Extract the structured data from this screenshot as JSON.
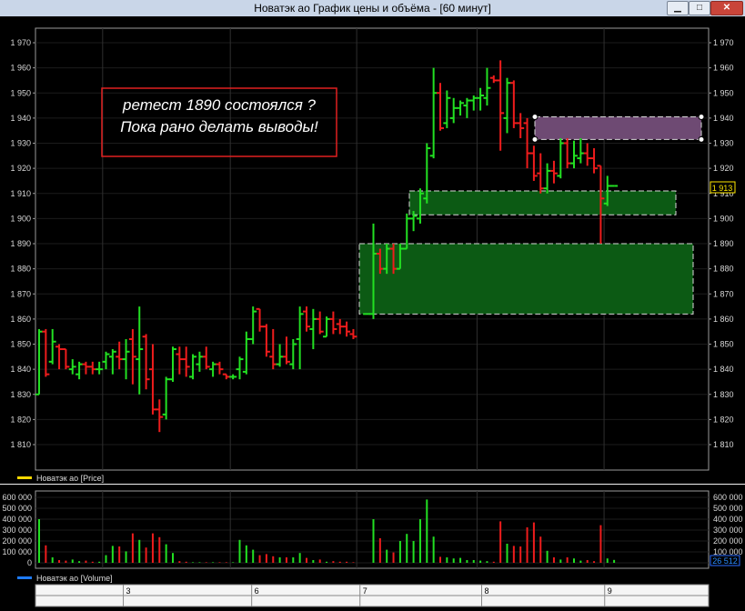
{
  "window": {
    "title": "Новатэк ао График цены и объёма - [60 минут]",
    "buttons": {
      "minimize": "▁",
      "maximize": "□",
      "close": "✕"
    }
  },
  "price_panel": {
    "legend": "Новатэк ао [Price]",
    "legend_color": "#ffd800",
    "current_price_label": "1 913",
    "y_ticks": [
      "1 970",
      "1 960",
      "1 950",
      "1 940",
      "1 930",
      "1 920",
      "1 910",
      "1 900",
      "1 890",
      "1 880",
      "1 870",
      "1 860",
      "1 850",
      "1 840",
      "1 830",
      "1 820",
      "1 810"
    ]
  },
  "volume_panel": {
    "legend": "Новатэк ао [Volume]",
    "legend_color": "#1e7bff",
    "current_volume_label": "26 512",
    "y_ticks": [
      "600 000",
      "500 000",
      "400 000",
      "300 000",
      "200 000",
      "100 000",
      "0"
    ]
  },
  "annotation": {
    "line1": "ретест 1890  состоялся ?",
    "line2": "Пока рано делать выводы!"
  },
  "x_axis": {
    "day_labels": [
      "3",
      "6",
      "7",
      "8",
      "9"
    ]
  },
  "colors": {
    "up": "#22e022",
    "down": "#ee1c1c",
    "background": "#000000",
    "grid": "#3a3a3a",
    "zone_green": "#0c5a14",
    "zone_purple": "#6e4a73"
  },
  "zones": [
    {
      "name": "zone-resistance-1930-1940",
      "from": 1931.5,
      "to": 1940.5,
      "kind": "purple"
    },
    {
      "name": "zone-support-1901-1911",
      "from": 1901.5,
      "to": 1911,
      "kind": "green"
    },
    {
      "name": "zone-support-1862-1890",
      "from": 1862,
      "to": 1890,
      "kind": "green"
    }
  ],
  "chart_data": {
    "type": "ohlc",
    "period": "60 минут",
    "ylim": [
      1802,
      1974
    ],
    "candles": [
      {
        "o": 1830,
        "h": 1856,
        "l": 1830,
        "c": 1855
      },
      {
        "o": 1855,
        "h": 1856,
        "l": 1837,
        "c": 1838
      },
      {
        "o": 1843,
        "h": 1856,
        "l": 1842,
        "c": 1851
      },
      {
        "o": 1849,
        "h": 1850,
        "l": 1840,
        "c": 1848
      },
      {
        "o": 1848,
        "h": 1848,
        "l": 1840,
        "c": 1841
      },
      {
        "o": 1840,
        "h": 1844,
        "l": 1838,
        "c": 1841
      },
      {
        "o": 1838,
        "h": 1843,
        "l": 1836,
        "c": 1842
      },
      {
        "o": 1842,
        "h": 1843,
        "l": 1838,
        "c": 1841
      },
      {
        "o": 1841,
        "h": 1843,
        "l": 1838,
        "c": 1840
      },
      {
        "o": 1840,
        "h": 1843,
        "l": 1838,
        "c": 1840
      },
      {
        "o": 1843,
        "h": 1847,
        "l": 1840,
        "c": 1846
      },
      {
        "o": 1845,
        "h": 1848,
        "l": 1838,
        "c": 1847
      },
      {
        "o": 1845,
        "h": 1851,
        "l": 1840,
        "c": 1844
      },
      {
        "o": 1844,
        "h": 1852,
        "l": 1836,
        "c": 1847
      },
      {
        "o": 1852,
        "h": 1856,
        "l": 1834,
        "c": 1845
      },
      {
        "o": 1844,
        "h": 1865,
        "l": 1830,
        "c": 1848
      },
      {
        "o": 1853,
        "h": 1854,
        "l": 1832,
        "c": 1836
      },
      {
        "o": 1840,
        "h": 1850,
        "l": 1822,
        "c": 1824
      },
      {
        "o": 1824,
        "h": 1828,
        "l": 1815,
        "c": 1821
      },
      {
        "o": 1822,
        "h": 1837,
        "l": 1820,
        "c": 1836
      },
      {
        "o": 1836,
        "h": 1849,
        "l": 1835,
        "c": 1848
      },
      {
        "o": 1846,
        "h": 1849,
        "l": 1838,
        "c": 1844
      },
      {
        "o": 1844,
        "h": 1849,
        "l": 1837,
        "c": 1841
      },
      {
        "o": 1837,
        "h": 1846,
        "l": 1836,
        "c": 1845
      },
      {
        "o": 1842,
        "h": 1847,
        "l": 1839,
        "c": 1845
      },
      {
        "o": 1845,
        "h": 1849,
        "l": 1840,
        "c": 1841
      },
      {
        "o": 1840,
        "h": 1843,
        "l": 1837,
        "c": 1842
      },
      {
        "o": 1842,
        "h": 1843,
        "l": 1838,
        "c": 1840
      },
      {
        "o": 1838,
        "h": 1838,
        "l": 1836,
        "c": 1837
      },
      {
        "o": 1837,
        "h": 1838,
        "l": 1836,
        "c": 1837
      },
      {
        "o": 1840,
        "h": 1845,
        "l": 1836,
        "c": 1844
      },
      {
        "o": 1839,
        "h": 1855,
        "l": 1838,
        "c": 1852
      },
      {
        "o": 1852,
        "h": 1865,
        "l": 1850,
        "c": 1863
      },
      {
        "o": 1864,
        "h": 1864,
        "l": 1855,
        "c": 1857
      },
      {
        "o": 1857,
        "h": 1858,
        "l": 1845,
        "c": 1847
      },
      {
        "o": 1845,
        "h": 1856,
        "l": 1840,
        "c": 1842
      },
      {
        "o": 1842,
        "h": 1850,
        "l": 1841,
        "c": 1845
      },
      {
        "o": 1845,
        "h": 1853,
        "l": 1842,
        "c": 1843
      },
      {
        "o": 1842,
        "h": 1852,
        "l": 1840,
        "c": 1850
      },
      {
        "o": 1852,
        "h": 1865,
        "l": 1840,
        "c": 1862
      },
      {
        "o": 1863,
        "h": 1865,
        "l": 1855,
        "c": 1857
      },
      {
        "o": 1856,
        "h": 1864,
        "l": 1848,
        "c": 1860
      },
      {
        "o": 1860,
        "h": 1863,
        "l": 1854,
        "c": 1855
      },
      {
        "o": 1853,
        "h": 1861,
        "l": 1853,
        "c": 1860
      },
      {
        "o": 1860,
        "h": 1863,
        "l": 1854,
        "c": 1856
      },
      {
        "o": 1858,
        "h": 1860,
        "l": 1854,
        "c": 1857
      },
      {
        "o": 1857,
        "h": 1859,
        "l": 1853,
        "c": 1855
      },
      {
        "o": 1854,
        "h": 1856,
        "l": 1852,
        "c": 1853
      },
      null,
      {
        "o": 1862,
        "h": 1862,
        "l": 1862,
        "c": 1862
      },
      {
        "o": 1862,
        "h": 1898,
        "l": 1860,
        "c": 1886
      },
      {
        "o": 1886,
        "h": 1888,
        "l": 1878,
        "c": 1880
      },
      {
        "o": 1880,
        "h": 1890,
        "l": 1878,
        "c": 1888
      },
      {
        "o": 1888,
        "h": 1890,
        "l": 1878,
        "c": 1880
      },
      {
        "o": 1880,
        "h": 1890,
        "l": 1880,
        "c": 1888
      },
      {
        "o": 1888,
        "h": 1902,
        "l": 1888,
        "c": 1900
      },
      {
        "o": 1900,
        "h": 1903,
        "l": 1895,
        "c": 1901
      },
      {
        "o": 1900,
        "h": 1912,
        "l": 1898,
        "c": 1910
      },
      {
        "o": 1908,
        "h": 1930,
        "l": 1906,
        "c": 1928
      },
      {
        "o": 1925,
        "h": 1960,
        "l": 1924,
        "c": 1950
      },
      {
        "o": 1950,
        "h": 1954,
        "l": 1935,
        "c": 1936
      },
      {
        "o": 1938,
        "h": 1951,
        "l": 1936,
        "c": 1948
      },
      {
        "o": 1940,
        "h": 1948,
        "l": 1938,
        "c": 1944
      },
      {
        "o": 1944,
        "h": 1947,
        "l": 1941,
        "c": 1946
      },
      {
        "o": 1945,
        "h": 1948,
        "l": 1940,
        "c": 1947
      },
      {
        "o": 1947,
        "h": 1949,
        "l": 1943,
        "c": 1948
      },
      {
        "o": 1948,
        "h": 1952,
        "l": 1943,
        "c": 1949
      },
      {
        "o": 1948,
        "h": 1960,
        "l": 1945,
        "c": 1952
      },
      {
        "o": 1956,
        "h": 1957,
        "l": 1954,
        "c": 1955
      },
      {
        "o": 1955,
        "h": 1963,
        "l": 1927,
        "c": 1942
      },
      {
        "o": 1940,
        "h": 1956,
        "l": 1934,
        "c": 1954
      },
      {
        "o": 1954,
        "h": 1955,
        "l": 1936,
        "c": 1938
      },
      {
        "o": 1938,
        "h": 1942,
        "l": 1932,
        "c": 1936
      },
      {
        "o": 1938,
        "h": 1940,
        "l": 1920,
        "c": 1926
      },
      {
        "o": 1926,
        "h": 1929,
        "l": 1915,
        "c": 1917
      },
      {
        "o": 1918,
        "h": 1926,
        "l": 1910,
        "c": 1912
      },
      {
        "o": 1912,
        "h": 1922,
        "l": 1910,
        "c": 1919
      },
      {
        "o": 1919,
        "h": 1923,
        "l": 1914,
        "c": 1918
      },
      {
        "o": 1917,
        "h": 1932,
        "l": 1916,
        "c": 1930
      },
      {
        "o": 1930,
        "h": 1932,
        "l": 1920,
        "c": 1922
      },
      {
        "o": 1922,
        "h": 1931,
        "l": 1920,
        "c": 1925
      },
      {
        "o": 1924,
        "h": 1932,
        "l": 1922,
        "c": 1926
      },
      {
        "o": 1926,
        "h": 1930,
        "l": 1921,
        "c": 1924
      },
      {
        "o": 1924,
        "h": 1928,
        "l": 1918,
        "c": 1920
      },
      {
        "o": 1921,
        "h": 1921,
        "l": 1890,
        "c": 1908
      },
      {
        "o": 1906,
        "h": 1917,
        "l": 1905,
        "c": 1913
      },
      {
        "o": 1913,
        "h": 1913,
        "l": 1913,
        "c": 1913
      }
    ],
    "volumes": [
      400000,
      160000,
      50000,
      25000,
      20000,
      30000,
      15000,
      20000,
      10000,
      10000,
      70000,
      155000,
      150000,
      105000,
      270000,
      210000,
      140000,
      270000,
      235000,
      170000,
      90000,
      15000,
      10000,
      5000,
      5000,
      5000,
      5000,
      5000,
      5000,
      5000,
      210000,
      160000,
      120000,
      70000,
      80000,
      60000,
      50000,
      50000,
      50000,
      90000,
      45000,
      25000,
      30000,
      10000,
      15000,
      10000,
      10000,
      5000,
      0,
      0,
      400000,
      225000,
      120000,
      95000,
      200000,
      265000,
      200000,
      400000,
      580000,
      240000,
      55000,
      50000,
      40000,
      45000,
      25000,
      25000,
      20000,
      15000,
      10000,
      380000,
      175000,
      155000,
      150000,
      325000,
      370000,
      240000,
      110000,
      50000,
      30000,
      50000,
      40000,
      20000,
      25000,
      15000,
      345000,
      40000,
      26512
    ]
  }
}
